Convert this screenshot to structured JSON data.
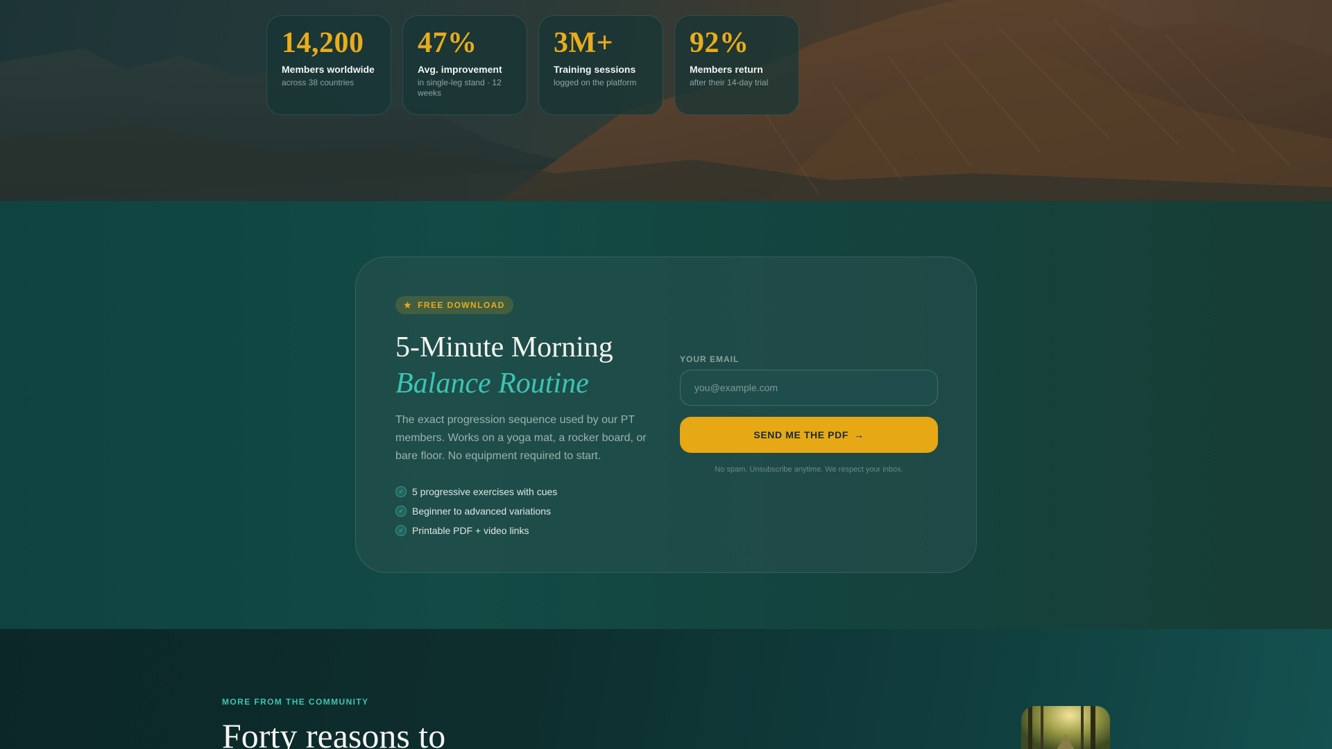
{
  "stats": [
    {
      "value": "14,200",
      "label": "Members worldwide",
      "sub": "across 38 countries"
    },
    {
      "value": "47%",
      "label": "Avg. improvement",
      "sub": "in single-leg stand · 12 weeks"
    },
    {
      "value": "3M+",
      "label": "Training sessions",
      "sub": "logged on the platform"
    },
    {
      "value": "92%",
      "label": "Members return",
      "sub": "after their 14-day trial"
    }
  ],
  "download": {
    "badge_icon": "★",
    "badge": "FREE DOWNLOAD",
    "title_line1": "5-Minute Morning",
    "title_line2": "Balance Routine",
    "description": "The exact progression sequence used by our PT members. Works on a yoga mat, a rocker board, or bare floor. No equipment required to start.",
    "checklist": [
      "5 progressive exercises with cues",
      "Beginner to advanced variations",
      "Printable PDF + video links"
    ],
    "email_label": "YOUR EMAIL",
    "email_placeholder": "you@example.com",
    "email_value": "",
    "button_label": "SEND ME THE PDF",
    "button_icon": "→",
    "note": "No spam. Unsubscribe anytime. We respect your inbox."
  },
  "community": {
    "eyebrow": "MORE FROM THE COMMUNITY",
    "title": "Forty reasons to"
  },
  "icons": {
    "star": "star-icon",
    "check": "check-circle-icon",
    "arrow": "arrow-right-icon"
  },
  "colors": {
    "accent_gold": "#e6a815",
    "accent_teal": "#3cc5b4",
    "section_bg": "#124a45"
  }
}
